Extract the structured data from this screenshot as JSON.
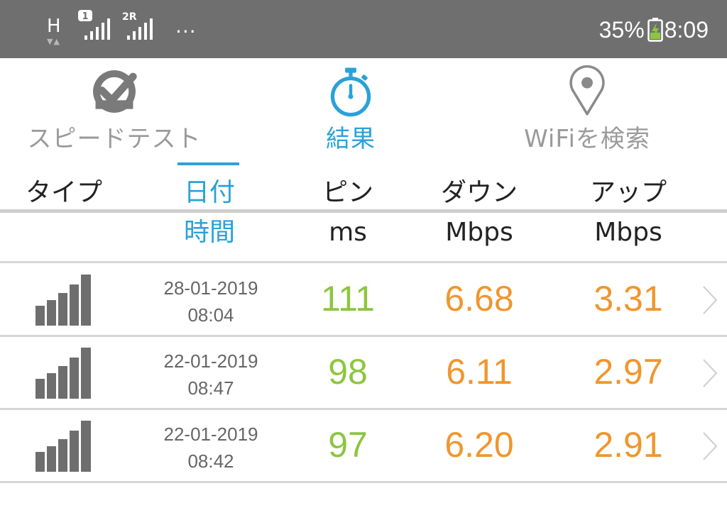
{
  "status_bar": {
    "network_type": "H",
    "sim1_badge": "1",
    "sim2_badge": "2R",
    "more": "...",
    "battery_percent": "35%",
    "time": "8:09"
  },
  "tabs": [
    {
      "label": "スピードテスト",
      "icon": "speedometer-check-icon",
      "active": false
    },
    {
      "label": "結果",
      "icon": "stopwatch-icon",
      "active": true
    },
    {
      "label": "WiFiを検索",
      "icon": "location-pin-icon",
      "active": false
    }
  ],
  "table_header": {
    "type": {
      "line1": "タイプ",
      "line2": ""
    },
    "date": {
      "line1": "日付",
      "line2": "時間"
    },
    "ping": {
      "line1": "ピン",
      "line2": "ms"
    },
    "download": {
      "line1": "ダウン",
      "line2": "Mbps"
    },
    "upload": {
      "line1": "アップ",
      "line2": "Mbps"
    }
  },
  "rows": [
    {
      "type_icon": "cellular-signal-icon",
      "date": "28-01-2019",
      "time": "08:04",
      "ping": "111",
      "download": "6.68",
      "upload": "3.31"
    },
    {
      "type_icon": "cellular-signal-icon",
      "date": "22-01-2019",
      "time": "08:47",
      "ping": "98",
      "download": "6.11",
      "upload": "2.97"
    },
    {
      "type_icon": "cellular-signal-icon",
      "date": "22-01-2019",
      "time": "08:42",
      "ping": "97",
      "download": "6.20",
      "upload": "2.91"
    }
  ],
  "colors": {
    "accent": "#2aa2d8",
    "ping": "#8cc63f",
    "speed": "#f0962e",
    "status_bar": "#6f6f6f",
    "inactive": "#9a9a9a"
  }
}
